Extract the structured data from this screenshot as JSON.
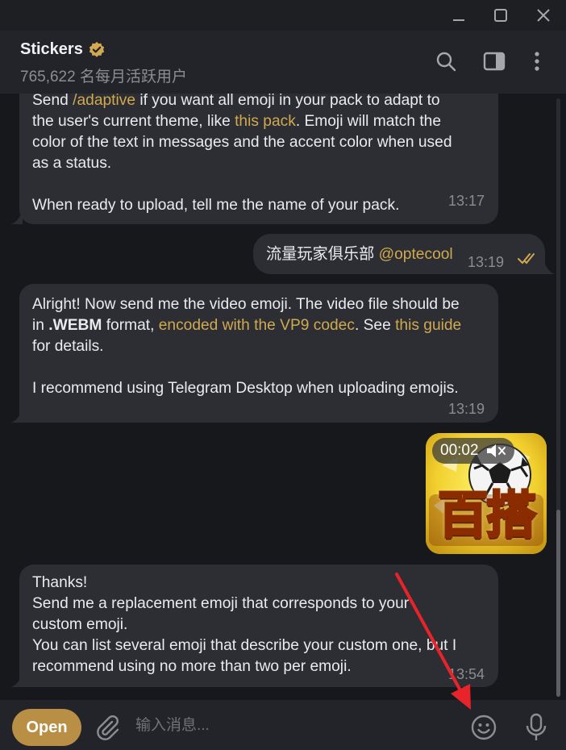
{
  "window": {
    "controls": [
      "minimize-icon",
      "maximize-icon",
      "close-icon"
    ]
  },
  "header": {
    "title": "Stickers",
    "subtitle": "765,622 名每月活跃用户",
    "icons": [
      "search-icon",
      "sidebar-toggle-icon",
      "more-vertical-icon"
    ]
  },
  "messages": {
    "m1": {
      "l1": {
        "a": "Send ",
        "link": "/adaptive",
        "b": " if you want all emoji in your pack to adapt to"
      },
      "l2": {
        "a": "the user's current theme, like ",
        "link": "this pack",
        "b": ". Emoji will match the"
      },
      "l3": "color of the text in messages and the accent color when used",
      "l4": "as a status.",
      "l5": "When ready to upload, tell me the name of your pack.",
      "time": "13:17"
    },
    "m2": {
      "text": "流量玩家俱乐部 ",
      "mention": "@optecool",
      "time": "13:19",
      "status_icon": "double-check-icon"
    },
    "m3": {
      "l1": "Alright! Now send me the video emoji. The video file should be",
      "l2": {
        "a": "in ",
        "bold": ".WEBM",
        "b": " format, ",
        "link1": "encoded with the VP9 codec",
        "c": ". See ",
        "link2": "this guide"
      },
      "l3": "for details.",
      "l4": "I recommend using Telegram Desktop when uploading emojis.",
      "time": "13:19"
    },
    "m4": {
      "duration": "00:02",
      "sound_icon": "muted-speaker-icon",
      "thumb_text": "百搭"
    },
    "m5": {
      "l1": "Thanks!",
      "l2": "Send me a replacement emoji that corresponds to your",
      "l3": "custom emoji.",
      "l4": "You can list several emoji that describe your custom one, but I",
      "l5": "recommend using no more than two per emoji.",
      "time": "13:54"
    }
  },
  "composer": {
    "open_label": "Open",
    "placeholder": "输入消息...",
    "icons": [
      "attach-icon",
      "emoji-icon",
      "microphone-icon"
    ]
  },
  "colors": {
    "accent": "#d1a94f",
    "open_button": "#b98e45",
    "bubble": "#2c2e34",
    "annotation_arrow": "#e8232a"
  }
}
